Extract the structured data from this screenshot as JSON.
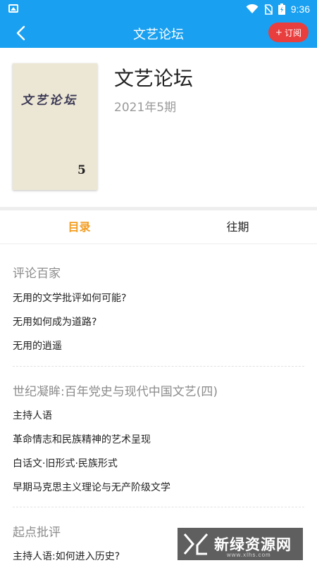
{
  "status_bar": {
    "time": "9:36"
  },
  "nav": {
    "title": "文艺论坛",
    "subscribe_label": "订阅",
    "subscribe_icon": "plus-icon",
    "back_icon": "back-arrow-icon"
  },
  "magazine": {
    "cover_title": "文艺论坛",
    "cover_issue": "5",
    "title": "文艺论坛",
    "issue": "2021年5期"
  },
  "tabs": [
    {
      "label": "目录",
      "active": true
    },
    {
      "label": "往期",
      "active": false
    }
  ],
  "sections": [
    {
      "title": "评论百家",
      "articles": [
        "无用的文学批评如何可能?",
        "无用如何成为道路?",
        "无用的逍遥"
      ]
    },
    {
      "title": "世纪凝眸:百年党史与现代中国文艺(四)",
      "articles": [
        "主持人语",
        "革命情志和民族精神的艺术呈现",
        "白话文·旧形式·民族形式",
        "早期马克思主义理论与无产阶级文学"
      ]
    },
    {
      "title": "起点批评",
      "articles": [
        "主持人语:如何进入历史?"
      ]
    }
  ],
  "watermark": {
    "text": "新绿资源网",
    "sub": "www.xlhs.com"
  },
  "colors": {
    "accent": "#1aa0f0",
    "active_tab": "#f39c1f",
    "subscribe": "#e83e3e"
  }
}
